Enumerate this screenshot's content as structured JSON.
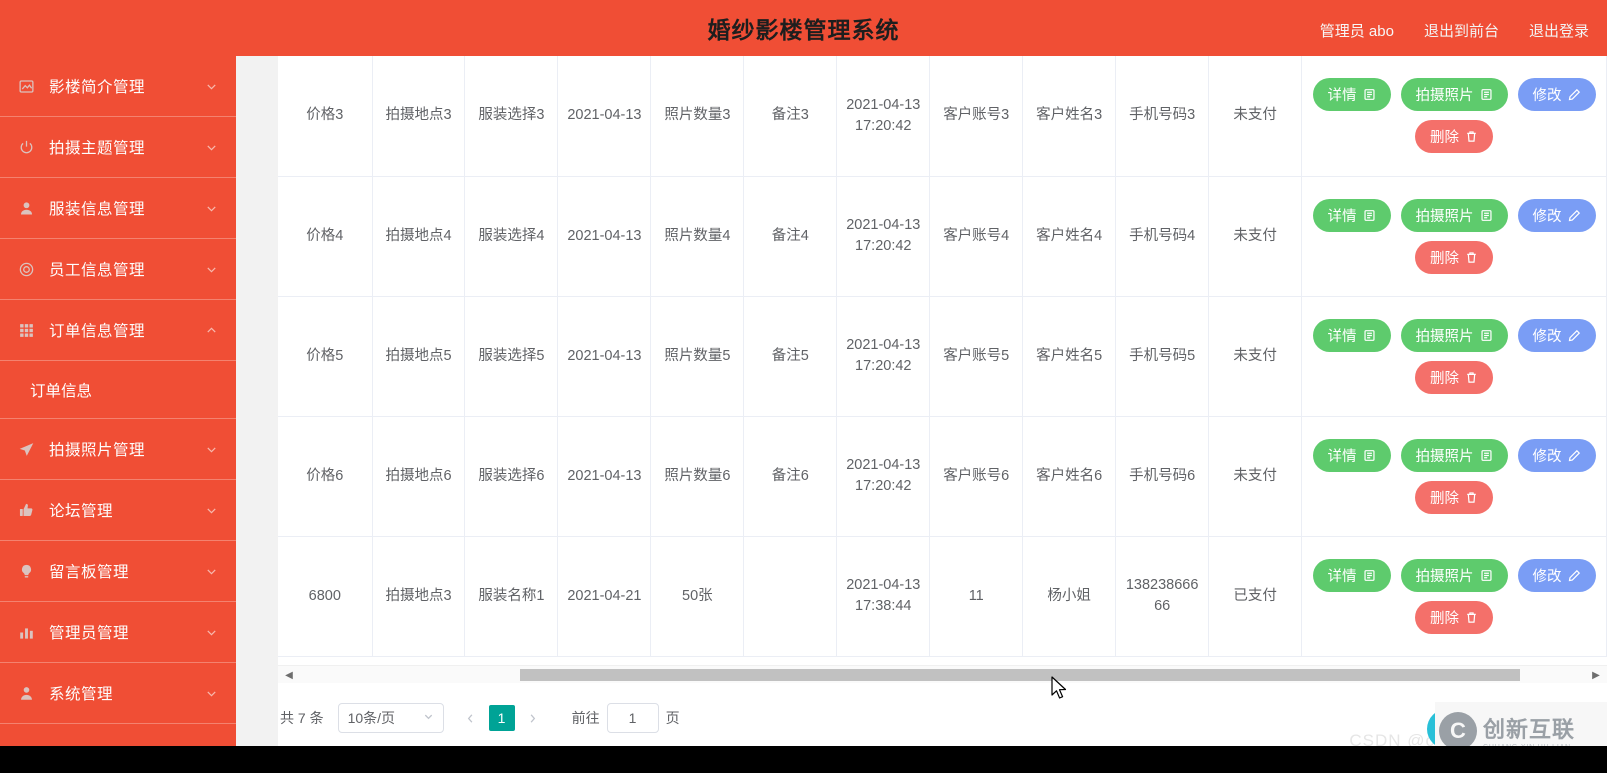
{
  "header": {
    "title": "婚纱影楼管理系统",
    "admin_label": "管理员 abo",
    "exit_front_label": "退出到前台",
    "logout_label": "退出登录"
  },
  "sidebar": {
    "items": [
      {
        "label": "影楼简介管理",
        "icon": "image-icon",
        "expanded": false
      },
      {
        "label": "拍摄主题管理",
        "icon": "power-icon",
        "expanded": false
      },
      {
        "label": "服装信息管理",
        "icon": "user-icon",
        "expanded": false
      },
      {
        "label": "员工信息管理",
        "icon": "target-icon",
        "expanded": false
      },
      {
        "label": "订单信息管理",
        "icon": "grid-icon",
        "expanded": true
      },
      {
        "label": "拍摄照片管理",
        "icon": "send-icon",
        "expanded": false
      },
      {
        "label": "论坛管理",
        "icon": "thumbs-up-icon",
        "expanded": false
      },
      {
        "label": "留言板管理",
        "icon": "bulb-icon",
        "expanded": false
      },
      {
        "label": "管理员管理",
        "icon": "bar-chart-icon",
        "expanded": false
      },
      {
        "label": "系统管理",
        "icon": "person-icon",
        "expanded": false
      }
    ],
    "submenu": {
      "parent_index": 4,
      "label": "订单信息"
    }
  },
  "table": {
    "rows": [
      {
        "price": "价格3",
        "location": "拍摄地点3",
        "costume": "服装选择3",
        "date": "2021-04-13",
        "photo_count": "照片数量3",
        "remark": "备注3",
        "created_at": "2021-04-13 17:20:42",
        "customer_account": "客户账号3",
        "customer_name": "客户姓名3",
        "phone": "手机号码3",
        "pay_status": "未支付"
      },
      {
        "price": "价格4",
        "location": "拍摄地点4",
        "costume": "服装选择4",
        "date": "2021-04-13",
        "photo_count": "照片数量4",
        "remark": "备注4",
        "created_at": "2021-04-13 17:20:42",
        "customer_account": "客户账号4",
        "customer_name": "客户姓名4",
        "phone": "手机号码4",
        "pay_status": "未支付"
      },
      {
        "price": "价格5",
        "location": "拍摄地点5",
        "costume": "服装选择5",
        "date": "2021-04-13",
        "photo_count": "照片数量5",
        "remark": "备注5",
        "created_at": "2021-04-13 17:20:42",
        "customer_account": "客户账号5",
        "customer_name": "客户姓名5",
        "phone": "手机号码5",
        "pay_status": "未支付"
      },
      {
        "price": "价格6",
        "location": "拍摄地点6",
        "costume": "服装选择6",
        "date": "2021-04-13",
        "photo_count": "照片数量6",
        "remark": "备注6",
        "created_at": "2021-04-13 17:20:42",
        "customer_account": "客户账号6",
        "customer_name": "客户姓名6",
        "phone": "手机号码6",
        "pay_status": "未支付"
      },
      {
        "price": "6800",
        "location": "拍摄地点3",
        "costume": "服装名称1",
        "date": "2021-04-21",
        "photo_count": "50张",
        "remark": "",
        "created_at": "2021-04-13 17:38:44",
        "customer_account": "11",
        "customer_name": "杨小姐",
        "phone": "13823866666",
        "pay_status": "已支付"
      }
    ],
    "actions": {
      "detail_label": "详情",
      "photos_label": "拍摄照片",
      "edit_label": "修改",
      "delete_label": "删除"
    }
  },
  "pagination": {
    "total_label": "共 7 条",
    "page_size_label": "10条/页",
    "current_page": "1",
    "jump_prefix": "前往",
    "jump_value": "1",
    "jump_suffix": "页"
  },
  "watermark": {
    "csdn": "CSDN @c",
    "logo_cn": "创新互联",
    "logo_en": "CHUANG XIN HU LIAN",
    "logo_glyph": "C"
  },
  "colors": {
    "brand_orange": "#F04E35",
    "success_green": "#5ecb6d",
    "primary_blue": "#7a9df5",
    "danger_red": "#f4706a",
    "page_active_teal": "#00a396"
  }
}
